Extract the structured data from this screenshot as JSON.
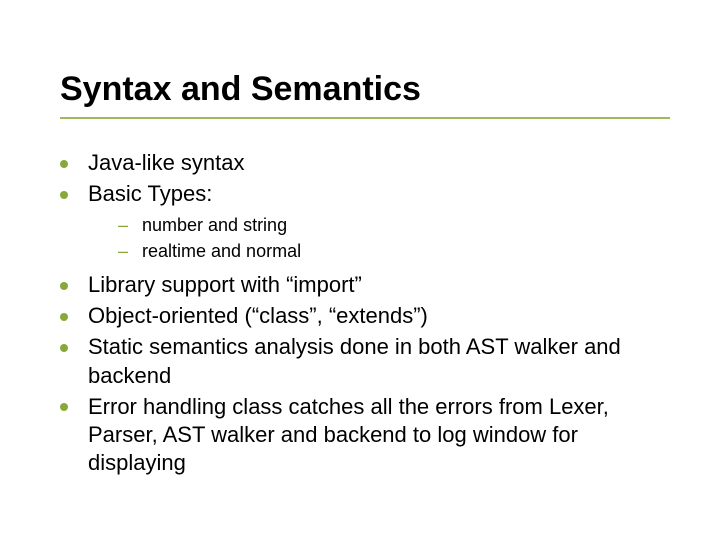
{
  "title": "Syntax and Semantics",
  "bullets": {
    "b1": "Java-like syntax",
    "b2": "Basic Types:",
    "b2_sub1": "number and string",
    "b2_sub2": "realtime and normal",
    "b3": "Library support with “import”",
    "b4": "Object-oriented (“class”, “extends”)",
    "b5": "Static semantics analysis done in both AST walker and backend",
    "b6": "Error handling class catches all the errors from Lexer, Parser, AST walker and backend to log window for displaying"
  }
}
